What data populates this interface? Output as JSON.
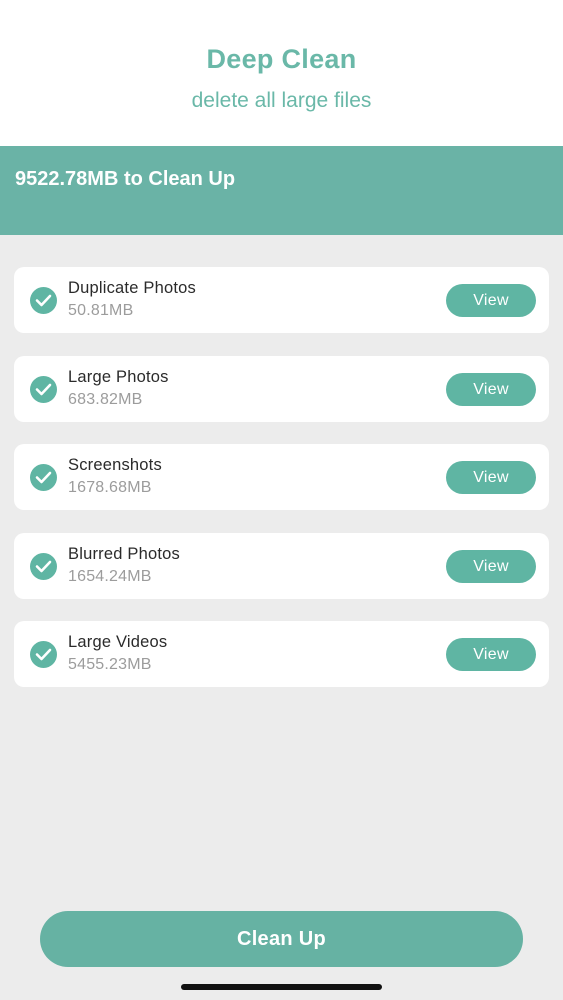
{
  "header": {
    "title": "Deep Clean",
    "subtitle": "delete all large files"
  },
  "summary": {
    "text": "9522.78MB to Clean Up"
  },
  "items": [
    {
      "name": "Duplicate Photos",
      "size": "50.81MB",
      "checked": true,
      "button": "View"
    },
    {
      "name": "Large Photos",
      "size": "683.82MB",
      "checked": true,
      "button": "View"
    },
    {
      "name": "Screenshots",
      "size": "1678.68MB",
      "checked": true,
      "button": "View"
    },
    {
      "name": "Blurred Photos",
      "size": "1654.24MB",
      "checked": true,
      "button": "View"
    },
    {
      "name": "Large Videos",
      "size": "5455.23MB",
      "checked": true,
      "button": "View"
    }
  ],
  "footer": {
    "clean_button": "Clean Up"
  },
  "colors": {
    "accent": "#6ab3a6",
    "background": "#ececec",
    "card": "#ffffff"
  }
}
